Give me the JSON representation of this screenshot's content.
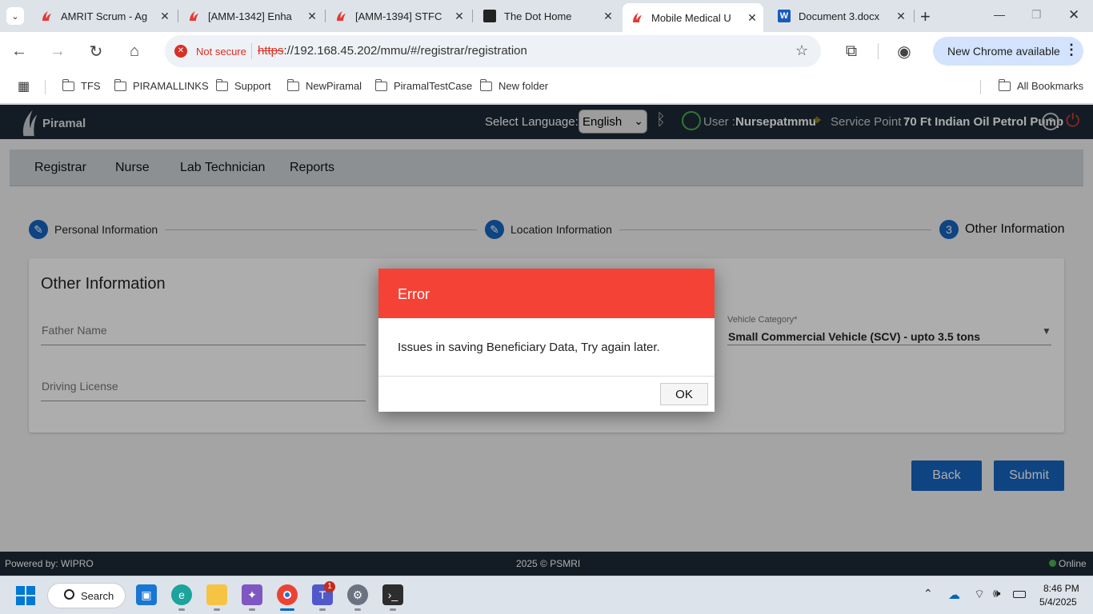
{
  "tabs": [
    {
      "title": "AMRIT Scrum - Ag",
      "close": "✕"
    },
    {
      "title": "[AMM-1342] Enha",
      "close": "✕"
    },
    {
      "title": "[AMM-1394] STFC",
      "close": "✕"
    },
    {
      "title": "The Dot Home",
      "close": "✕"
    },
    {
      "title": "Mobile Medical U",
      "close": "✕"
    },
    {
      "title": "Document 3.docx",
      "close": "✕"
    }
  ],
  "window_controls": {
    "new_tab": "+",
    "minimize": "—",
    "restore": "❐",
    "close": "✕"
  },
  "omnibox": {
    "security": "Not secure",
    "url_scheme": "https",
    "url_rest": "://192.168.45.202/mmu/#/registrar/registration"
  },
  "chrome_update": "New Chrome available",
  "bookmarks": [
    "TFS",
    "PIRAMALLINKS",
    "Support",
    "NewPiramal",
    "PiramalTestCase",
    "New folder"
  ],
  "all_bookmarks": "All Bookmarks",
  "app": {
    "logo": "Piramal",
    "select_language_label": "Select Language:",
    "language": "English",
    "user_label": "User :",
    "user_name": "Nursepatmmu",
    "service_point_label": "Service Point :",
    "service_point": "70 Ft Indian Oil Petrol Pump"
  },
  "nav": [
    "Registrar",
    "Nurse",
    "Lab Technician",
    "Reports"
  ],
  "steps": [
    {
      "icon": "✎",
      "label": "Personal Information"
    },
    {
      "icon": "✎",
      "label": "Location Information"
    },
    {
      "icon": "3",
      "label": "Other Information"
    }
  ],
  "form": {
    "title": "Other Information",
    "father_name": "Father Name",
    "driving_license": "Driving License",
    "vehicle_category_label": "Vehicle Category*",
    "vehicle_category_value": "Small Commercial Vehicle (SCV) - upto 3.5 tons"
  },
  "buttons": {
    "back": "Back",
    "submit": "Submit"
  },
  "footer": {
    "powered": "Powered by: WIPRO",
    "copyright": "2025 © PSMRI",
    "status": "Online"
  },
  "dialog": {
    "title": "Error",
    "message": "Issues in saving Beneficiary Data, Try again later.",
    "ok": "OK"
  },
  "taskbar": {
    "search": "Search",
    "teams_badge": "1",
    "time": "8:46 PM",
    "date": "5/4/2025"
  },
  "colors": {
    "primary": "#1565c0",
    "error_header": "#f44336",
    "app_header": "#1d2a36",
    "online": "#4caf50"
  }
}
